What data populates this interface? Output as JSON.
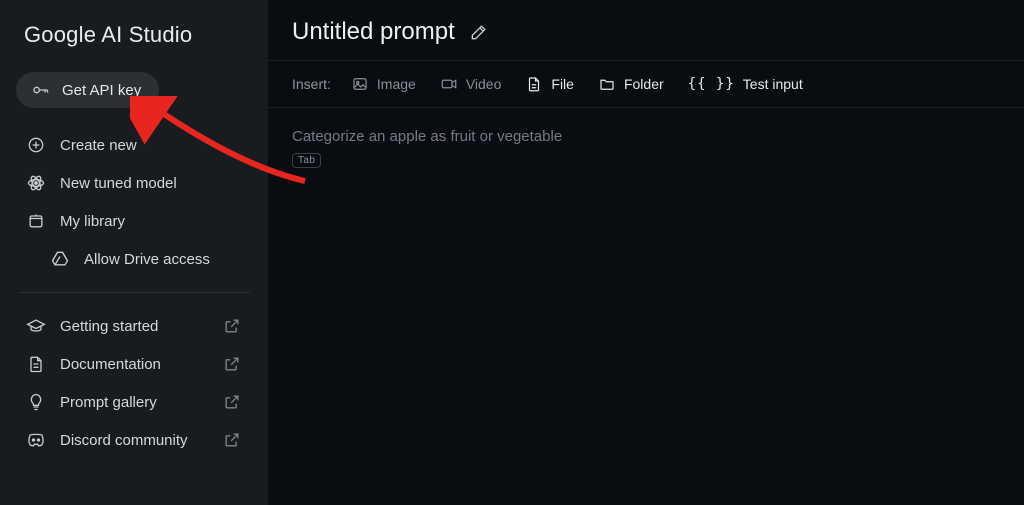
{
  "sidebar": {
    "logo": "Google AI Studio",
    "api_key_label": "Get API key",
    "items": {
      "create": "Create new",
      "tuned": "New tuned model",
      "library": "My library",
      "drive": "Allow Drive access",
      "getting_started": "Getting started",
      "documentation": "Documentation",
      "prompt_gallery": "Prompt gallery",
      "discord": "Discord community"
    }
  },
  "header": {
    "title": "Untitled prompt"
  },
  "toolbar": {
    "insert_label": "Insert:",
    "image": "Image",
    "video": "Video",
    "file": "File",
    "folder": "Folder",
    "test_input_braces": "{{ }}",
    "test_input": "Test input"
  },
  "editor": {
    "placeholder": "Categorize an apple as fruit or vegetable",
    "tab_hint": "Tab"
  }
}
